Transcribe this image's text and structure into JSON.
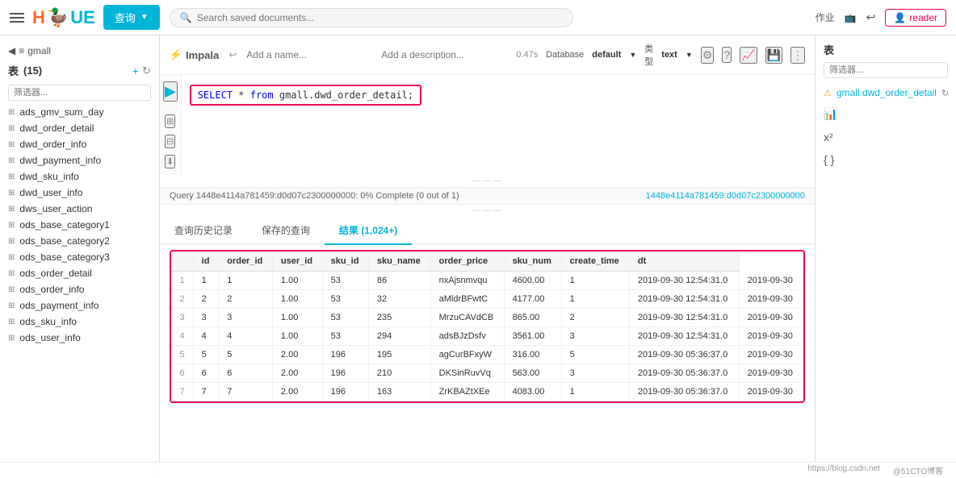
{
  "navbar": {
    "query_btn": "查询",
    "search_placeholder": "Search saved documents...",
    "right_text": "作业",
    "user_label": "reader"
  },
  "editor": {
    "tool": "Impala",
    "add_name": "Add a name...",
    "add_desc": "Add a description...",
    "sql": "SELECT * from gmall.dwd_order_detail;",
    "time": "0.47s",
    "db_label": "Database",
    "db_value": "default",
    "type_label": "类型",
    "type_value": "text",
    "query_text": "Query 1448e4114a781459:d0d07c2300000000: 0% Complete (0 out of 1)",
    "query_link": "1448e4114a781459:d0d07c2300000000"
  },
  "tabs": [
    {
      "label": "查询历史记录",
      "active": false
    },
    {
      "label": "保存的查询",
      "active": false
    },
    {
      "label": "结果 (1,024+)",
      "active": true
    }
  ],
  "table": {
    "columns": [
      "id",
      "order_id",
      "user_id",
      "sku_id",
      "sku_name",
      "order_price",
      "sku_num",
      "create_time",
      "dt"
    ],
    "rows": [
      [
        "1",
        "1",
        "1.00",
        "53",
        "86",
        "nxAjsnmvqu",
        "4600.00",
        "1",
        "2019-09-30 12:54:31.0",
        "2019-09-30"
      ],
      [
        "2",
        "2",
        "1.00",
        "53",
        "32",
        "aMldrBFwtC",
        "4177.00",
        "1",
        "2019-09-30 12:54:31.0",
        "2019-09-30"
      ],
      [
        "3",
        "3",
        "1.00",
        "53",
        "235",
        "MrzuCAVdCB",
        "865.00",
        "2",
        "2019-09-30 12:54:31.0",
        "2019-09-30"
      ],
      [
        "4",
        "4",
        "1.00",
        "53",
        "294",
        "adsBJzDsfv",
        "3561.00",
        "3",
        "2019-09-30 12:54:31.0",
        "2019-09-30"
      ],
      [
        "5",
        "5",
        "2.00",
        "196",
        "195",
        "agCurBFxyW",
        "316.00",
        "5",
        "2019-09-30 05:36:37.0",
        "2019-09-30"
      ],
      [
        "6",
        "6",
        "2.00",
        "196",
        "210",
        "DKSinRuvVq",
        "563.00",
        "3",
        "2019-09-30 05:36:37.0",
        "2019-09-30"
      ],
      [
        "7",
        "7",
        "2.00",
        "196",
        "163",
        "ZrKBAZtXEe",
        "4083.00",
        "1",
        "2019-09-30 05:36:37.0",
        "2019-09-30"
      ]
    ]
  },
  "sidebar": {
    "back_label": "gmall",
    "section_label": "表",
    "count": "(15)",
    "filter_placeholder": "筛选器...",
    "items": [
      "ads_gmv_sum_day",
      "dwd_order_detail",
      "dwd_order_info",
      "dwd_payment_info",
      "dwd_sku_info",
      "dwd_user_info",
      "dws_user_action",
      "ods_base_category1",
      "ods_base_category2",
      "ods_base_category3",
      "ods_order_detail",
      "ods_order_info",
      "ods_payment_info",
      "ods_sku_info",
      "ods_user_info"
    ]
  },
  "right_panel": {
    "title": "表",
    "filter_placeholder": "筛选器...",
    "item_label": "gmall.dwd_order_detail"
  },
  "footer": {
    "link1": "https://blog.csdn.net",
    "link2": "@51CTO博客"
  }
}
